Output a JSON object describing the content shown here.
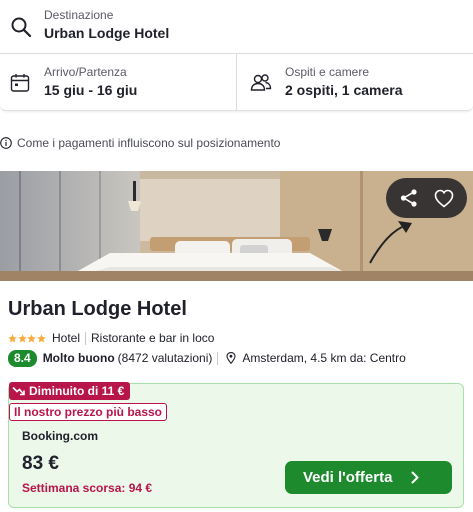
{
  "search": {
    "destination_label": "Destinazione",
    "destination_value": "Urban Lodge Hotel",
    "dates_label": "Arrivo/Partenza",
    "dates_value": "15 giu - 16 giu",
    "guests_label": "Ospiti e camere",
    "guests_value": "2 ospiti, 1 camera",
    "icons": [
      "search-icon",
      "calendar-icon",
      "guests-icon"
    ]
  },
  "info_line": {
    "text": "Come i pagamenti influiscono sul posizionamento",
    "icon": "info-icon"
  },
  "image_actions": {
    "icons": [
      "share-icon",
      "heart-icon"
    ]
  },
  "hotel": {
    "name": "Urban Lodge Hotel",
    "stars": 4,
    "type": "Hotel",
    "amenity": "Ristorante e bar in loco",
    "rating_score": "8.4",
    "rating_label": "Molto buono",
    "reviews": "(8472 valutazioni)",
    "location": "Amsterdam, 4.5 km da: Centro"
  },
  "deal": {
    "price_drop_badge": "Diminuito di 11 €",
    "best_price_badge": "Il nostro prezzo più basso",
    "provider": "Booking.com",
    "price": "83 €",
    "last_week": "Settimana scorsa: 94 €",
    "cta_label": "Vedi l'offerta"
  },
  "colors": {
    "accent_green": "#1d8a2e",
    "deal_background": "#ebf8ea",
    "deal_border": "#a9e0a9",
    "alert_red": "#b8154a",
    "star_yellow": "#f6ab3f"
  }
}
